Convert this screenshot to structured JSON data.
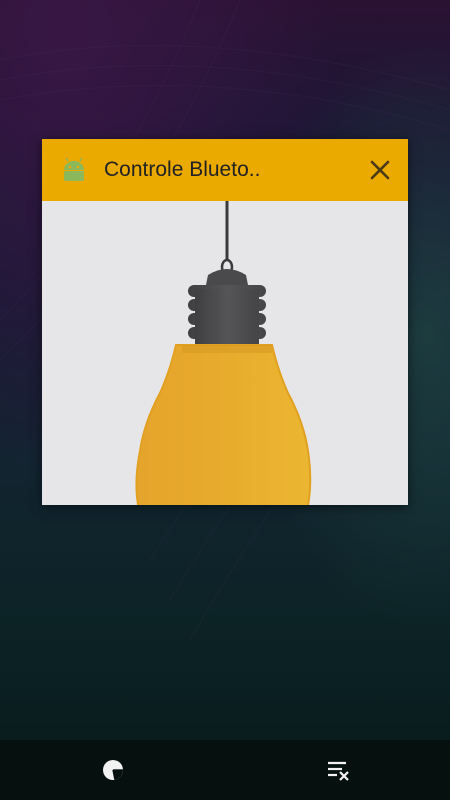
{
  "recents": {
    "cards": [
      {
        "app_name": "Controle Blueto..",
        "icon": "android-icon",
        "header_color": "#eaaa00"
      }
    ]
  },
  "navbar": {
    "memory_button_icon": "memory-usage-icon",
    "clear_all_button_icon": "clear-all-icon"
  },
  "colors": {
    "header": "#eaaa00",
    "bulb": "#e8ab2c",
    "socket": "#4a4a4c"
  }
}
